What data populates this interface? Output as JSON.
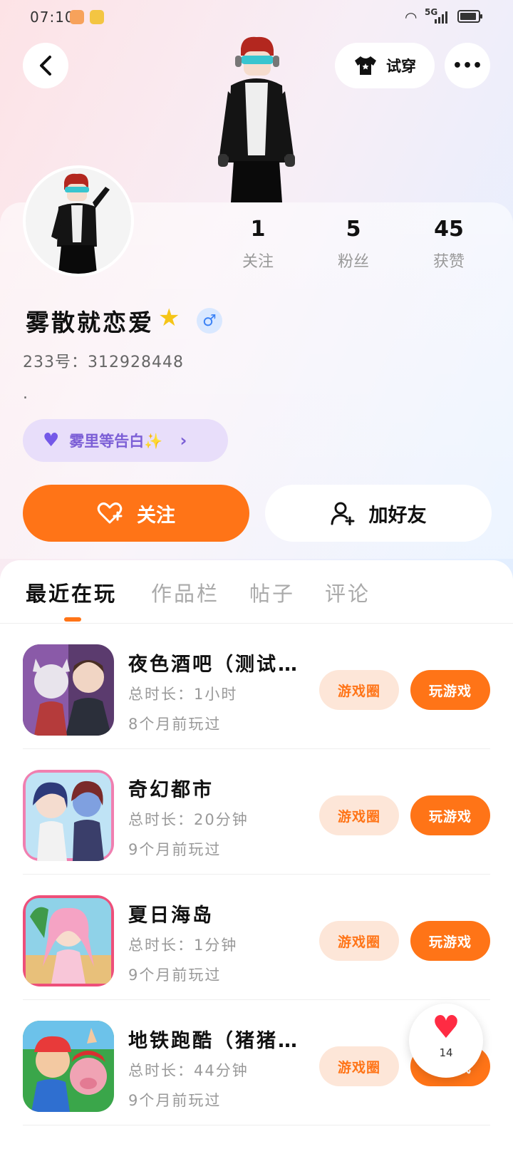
{
  "status_bar": {
    "time": "07:10",
    "network": "5G"
  },
  "header": {
    "try_on_label": "试穿",
    "more_label": "•••",
    "back_label": "‹"
  },
  "stats": [
    {
      "value": "1",
      "label": "关注"
    },
    {
      "value": "5",
      "label": "粉丝"
    },
    {
      "value": "45",
      "label": "获赞"
    }
  ],
  "profile": {
    "name": "雾散就恋爱",
    "gender_symbol": "♂",
    "uid": "233号：312928448",
    "bio": ".",
    "tag_label": "雾里等告白✨"
  },
  "actions": {
    "follow_label": "关注",
    "add_friend_label": "加好友"
  },
  "tabs": [
    {
      "label": "最近在玩",
      "active": true
    },
    {
      "label": "作品栏",
      "active": false
    },
    {
      "label": "帖子",
      "active": false
    },
    {
      "label": "评论",
      "active": false
    }
  ],
  "games": [
    {
      "name": "夜色酒吧（测试…",
      "duration": "总时长：1小时",
      "last_played": "8个月前玩过",
      "circle_label": "游戏圈",
      "play_label": "玩游戏"
    },
    {
      "name": "奇幻都市",
      "duration": "总时长：20分钟",
      "last_played": "9个月前玩过",
      "circle_label": "游戏圈",
      "play_label": "玩游戏"
    },
    {
      "name": "夏日海岛",
      "duration": "总时长：1分钟",
      "last_played": "9个月前玩过",
      "circle_label": "游戏圈",
      "play_label": "玩游戏"
    },
    {
      "name": "地铁跑酷（猪猪…",
      "duration": "总时长：44分钟",
      "last_played": "9个月前玩过",
      "circle_label": "游戏圈",
      "play_label": "玩游戏"
    }
  ],
  "like_fab": {
    "count": "14"
  },
  "colors": {
    "accent": "#ff7417",
    "tag_bg": "#e8defa",
    "tag_text": "#7c5fd6"
  }
}
